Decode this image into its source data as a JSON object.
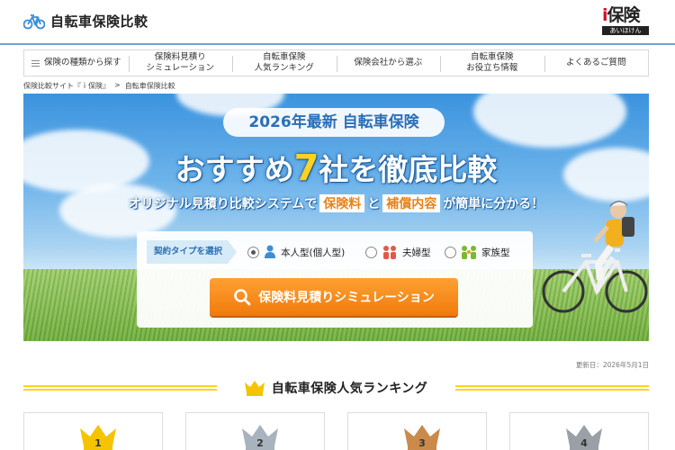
{
  "header": {
    "site_title": "自転車保険比較",
    "brand_name": "保険",
    "brand_i": "i",
    "brand_sub": "あいほけん"
  },
  "nav": [
    {
      "label_line1": "保険の種類から探す",
      "label_line2": ""
    },
    {
      "label_line1": "保険料見積り",
      "label_line2": "シミュレーション"
    },
    {
      "label_line1": "自転車保険",
      "label_line2": "人気ランキング"
    },
    {
      "label_line1": "保険会社から選ぶ",
      "label_line2": ""
    },
    {
      "label_line1": "自転車保険",
      "label_line2": "お役立ち情報"
    },
    {
      "label_line1": "よくあるご質問",
      "label_line2": ""
    }
  ],
  "breadcrumb": {
    "home": "保険比較サイト『ｉ保険』",
    "separator": ">",
    "current": "自転車保険比較"
  },
  "hero": {
    "pill": "2026年最新 自転車保険",
    "headline_pre": "おすすめ",
    "headline_num": "7",
    "headline_post": "社を徹底比較",
    "sub_pre": "オリジナル見積り比較システムで",
    "sub_hl1": "保険料",
    "sub_mid": "と",
    "sub_hl2": "補償内容",
    "sub_post": "が簡単に分かる！",
    "type_label": "契約タイプを選択",
    "options": [
      {
        "label": "本人型(個人型)",
        "selected": true
      },
      {
        "label": "夫婦型",
        "selected": false
      },
      {
        "label": "家族型",
        "selected": false
      }
    ],
    "sim_button": "保険料見積りシミュレーション"
  },
  "updated": "更新日：2026年5月1日",
  "ranking": {
    "title": "自転車保険人気ランキング",
    "cards": [
      {
        "rank": "1",
        "color": "#f5c400"
      },
      {
        "rank": "2",
        "color": "#a9b3bd"
      },
      {
        "rank": "3",
        "color": "#c98a4b"
      },
      {
        "rank": "4",
        "color": "#9aa0a6"
      }
    ]
  },
  "colors": {
    "accent": "#2b6fb8",
    "orange": "#f07a0c",
    "gold": "#ffd21e"
  }
}
